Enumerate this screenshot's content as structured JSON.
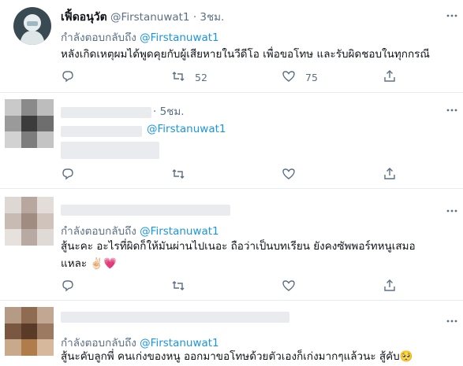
{
  "tweets": [
    {
      "name": "เฟิ้ดอนุวัต",
      "handle": "@Firstanuwat1",
      "time": "· 3ชม.",
      "reply_prefix": "กำลังตอบกลับถึง",
      "reply_mention": "@Firstanuwat1",
      "text_lines": [
        "หลังเกิดเหตุผมได้พูดคุยกับผู้เสียหายในวีดีโอ เพื่อขอโทษ และรับผิดชอบในทุกกรณี"
      ],
      "retweets": "52",
      "likes": "75"
    },
    {
      "time": "· 5ชม.",
      "reply_mention": "@Firstanuwat1",
      "text_lines": []
    },
    {
      "reply_prefix": "กำลังตอบกลับถึง",
      "reply_mention": "@Firstanuwat1",
      "text_lines": [
        "สู้นะคะ อะไรที่ผิดก็ให้มันผ่านไปเนอะ ถือว่าเป็นบทเรียน ยังคงซัพพอร์ทหนูเสมอ",
        "แหละ ✌🏻💗"
      ]
    },
    {
      "reply_prefix": "กำลังตอบกลับถึง",
      "reply_mention": "@Firstanuwat1",
      "text_lines": [
        "สู้นะคับลูกพี่ คนเก่งของหนู ออกมาขอโทษด้วยตัวเองก็เก่งมากๆแล้วนะ สู้คับ🥺"
      ]
    }
  ],
  "icons": {
    "reply": "reply-icon",
    "retweet": "retweet-icon",
    "like": "heart-icon",
    "share": "share-icon",
    "more": "more-icon"
  },
  "colors": {
    "link": "#1b95e0",
    "muted": "#5b7083",
    "divider": "#e6ecf0"
  }
}
